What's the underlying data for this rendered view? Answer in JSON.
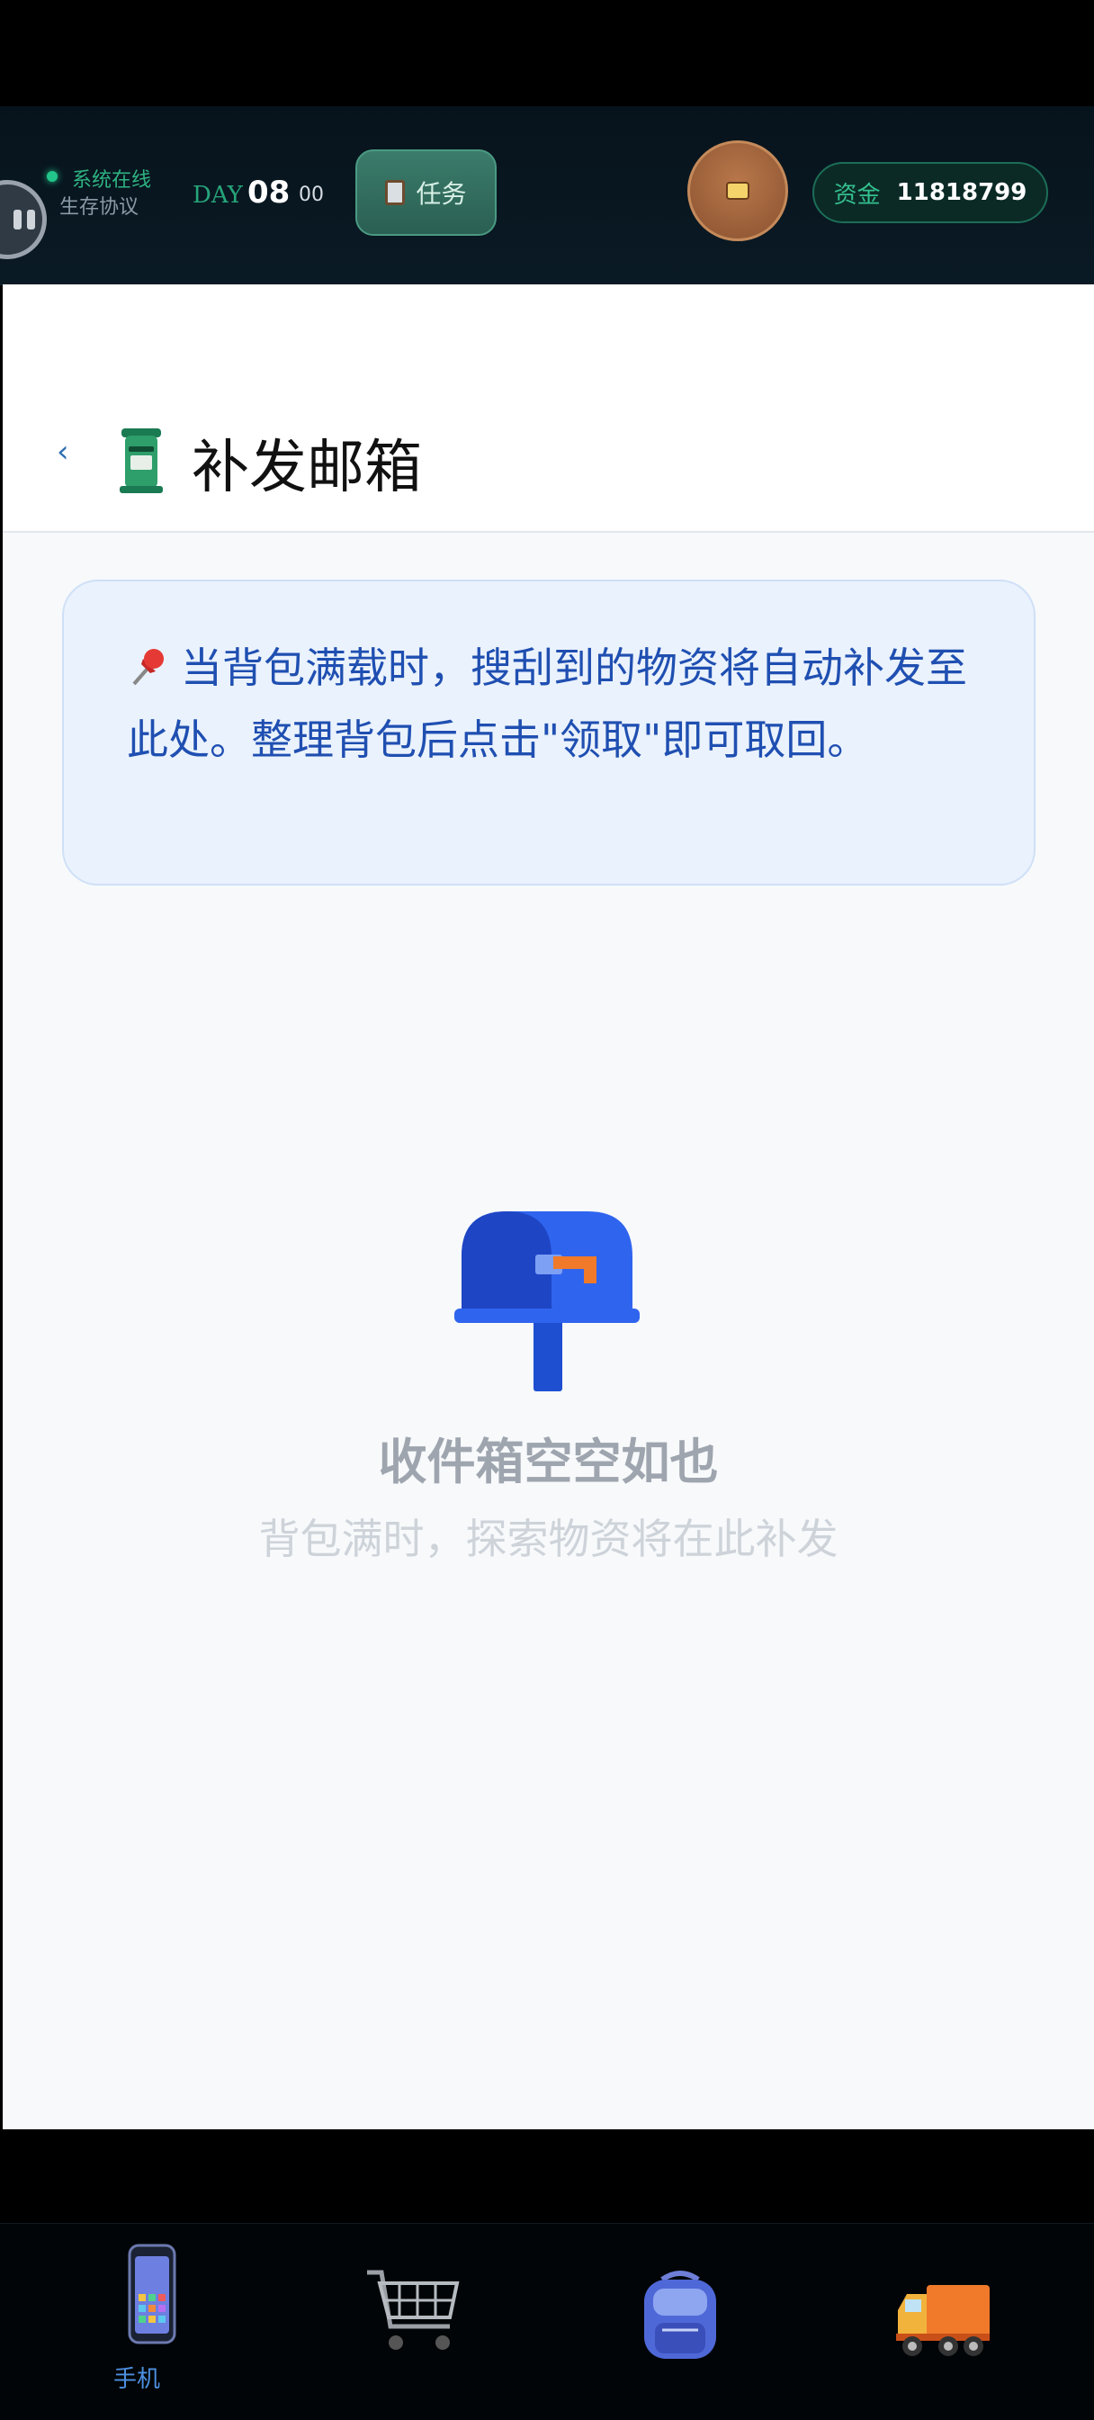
{
  "status": {
    "online_label": "系统在线",
    "protocol_label": "生存协议",
    "day_label": "DAY",
    "day_number": "08",
    "day_sub": "00",
    "task_label": "任务",
    "funds_label": "资金",
    "funds_value": "11818799"
  },
  "header": {
    "back_icon": "chevron-left-icon",
    "title": "补发邮箱"
  },
  "notice": {
    "text": "当背包满载时，搜刮到的物资将自动补发至此处。整理背包后点击\"领取\"即可取回。"
  },
  "empty": {
    "title": "收件箱空空如也",
    "subtitle": "背包满时，探索物资将在此补发"
  },
  "nav": {
    "items": [
      {
        "label": "手机",
        "icon": "phone-icon"
      },
      {
        "label": "",
        "icon": "cart-icon"
      },
      {
        "label": "",
        "icon": "backpack-icon"
      },
      {
        "label": "",
        "icon": "truck-icon"
      }
    ]
  },
  "colors": {
    "accent_green": "#2eb381",
    "notice_text": "#1f4fb1",
    "nav_active": "#4d8fe0"
  }
}
